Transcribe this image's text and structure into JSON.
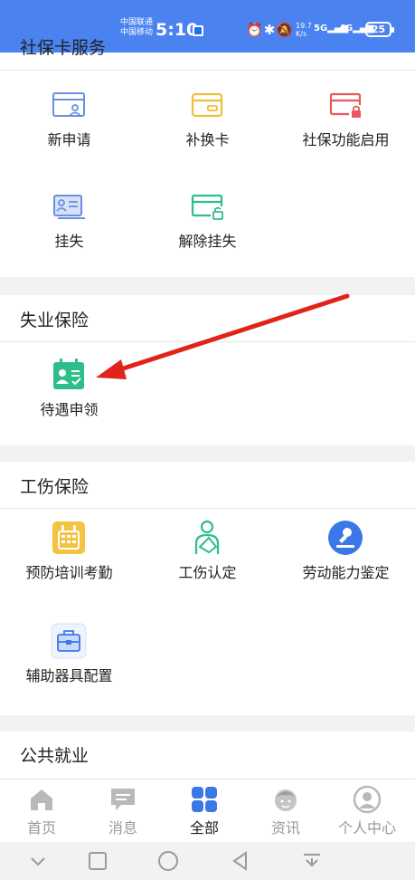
{
  "status_bar": {
    "carrier1": "中国联通",
    "carrier2": "中国移动",
    "time": "5:10",
    "net_speed_value": "19.7",
    "net_speed_unit": "K/s",
    "signal1": "5G",
    "signal2": "4G",
    "battery": "25"
  },
  "sections": {
    "social_card": {
      "title": "社保卡服务",
      "items": [
        {
          "label": "新申请",
          "icon": "id-card-person-icon"
        },
        {
          "label": "补换卡",
          "icon": "card-icon"
        },
        {
          "label": "社保功能启用",
          "icon": "card-lock-icon"
        },
        {
          "label": "挂失",
          "icon": "id-card-list-icon"
        },
        {
          "label": "解除挂失",
          "icon": "card-unlock-icon"
        }
      ]
    },
    "unemployment": {
      "title": "失业保险",
      "items": [
        {
          "label": "待遇申领",
          "icon": "calendar-person-icon"
        }
      ]
    },
    "injury": {
      "title": "工伤保险",
      "items": [
        {
          "label": "预防培训考勤",
          "icon": "calendar-grid-icon"
        },
        {
          "label": "工伤认定",
          "icon": "injured-person-icon"
        },
        {
          "label": "劳动能力鉴定",
          "icon": "stamp-icon"
        },
        {
          "label": "辅助器具配置",
          "icon": "toolbox-icon"
        }
      ]
    },
    "employment": {
      "title": "公共就业"
    }
  },
  "bottom_nav": [
    {
      "label": "首页",
      "icon": "home-icon",
      "active": false
    },
    {
      "label": "消息",
      "icon": "message-icon",
      "active": false
    },
    {
      "label": "全部",
      "icon": "grid-icon",
      "active": true
    },
    {
      "label": "资讯",
      "icon": "news-face-icon",
      "active": false
    },
    {
      "label": "个人中心",
      "icon": "user-icon",
      "active": false
    }
  ],
  "colors": {
    "status_bar": "#4a82f0",
    "accent_blue": "#3a78e8",
    "green": "#2dbe8a",
    "yellow": "#f5c242",
    "red": "#e8585e",
    "arrow": "#e0241b"
  }
}
